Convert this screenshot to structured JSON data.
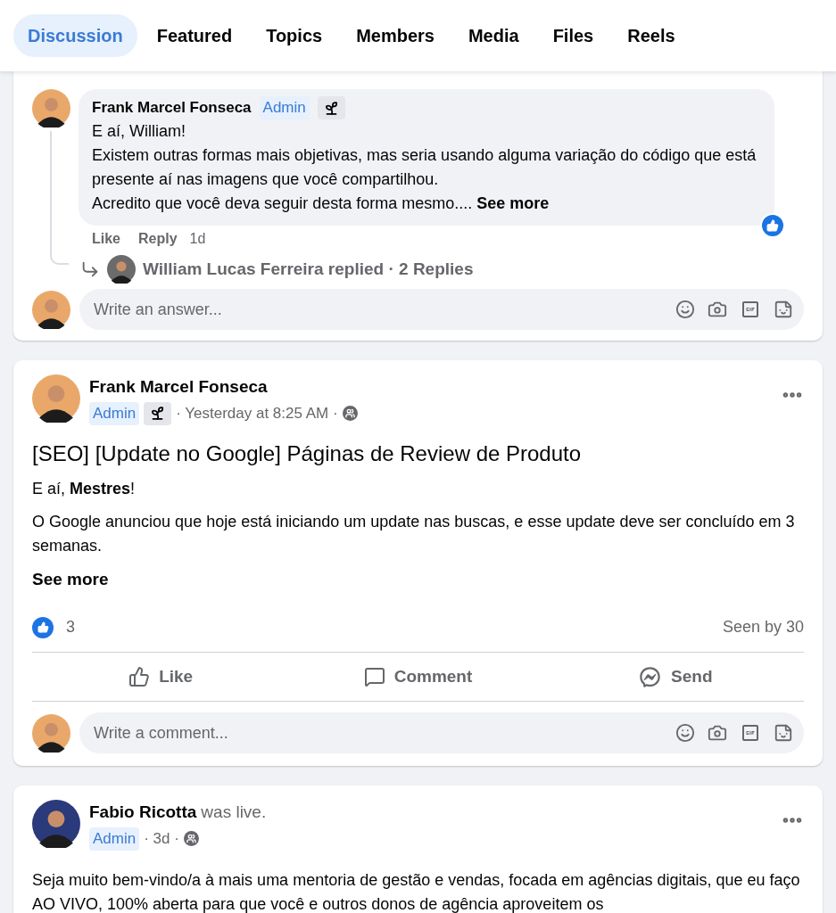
{
  "tabs": [
    {
      "label": "Discussion",
      "selected": true
    },
    {
      "label": "Featured",
      "selected": false
    },
    {
      "label": "Topics",
      "selected": false
    },
    {
      "label": "Members",
      "selected": false
    },
    {
      "label": "Media",
      "selected": false
    },
    {
      "label": "Files",
      "selected": false
    },
    {
      "label": "Reels",
      "selected": false
    }
  ],
  "comment_thread": {
    "comment": {
      "author": "Frank Marcel Fonseca",
      "badges": [
        {
          "kind": "admin",
          "label": "Admin"
        },
        {
          "kind": "sprout"
        }
      ],
      "paragraphs": [
        "E aí, William!",
        "Existem outras formas mais objetivas, mas seria usando alguma variação do código que está presente aí nas imagens que você compartilhou.",
        "Acredito que você deva seguir desta forma mesmo...."
      ],
      "see_more": "See more",
      "liked": true,
      "actions": [
        "Like",
        "Reply"
      ],
      "time": "1d"
    },
    "replies_summary": "William Lucas Ferreira replied · 2 Replies",
    "answer_field": {
      "placeholder": "Write an answer..."
    }
  },
  "posts": [
    {
      "author": "Frank Marcel Fonseca",
      "badges": [
        {
          "kind": "admin",
          "label": "Admin"
        },
        {
          "kind": "sprout"
        }
      ],
      "meta": "· Yesterday at 8:25 AM ·",
      "title": "[SEO] [Update no Google] Páginas de Review de Produto",
      "paragraphs": [
        "E aí, **Mestres**!",
        "O Google anunciou que hoje está iniciando um update nas buscas, e esse update deve ser concluído em 3 semanas."
      ],
      "see_more": "See more",
      "reactions_count": "3",
      "seen": "Seen by 30",
      "actions": [
        {
          "kind": "like",
          "label": "Like"
        },
        {
          "kind": "comment",
          "label": "Comment"
        },
        {
          "kind": "send",
          "label": "Send"
        }
      ],
      "comment_field": {
        "placeholder": "Write a comment..."
      }
    },
    {
      "author": "Fabio Ricotta",
      "suffix": "was live.",
      "badges": [
        {
          "kind": "admin",
          "label": "Admin"
        }
      ],
      "meta": "· 3d ·",
      "paragraphs": [
        "Seja muito bem-vindo/a à mais uma mentoria de gestão e vendas, focada em agências digitais, que eu faço AO VIVO, 100% aberta para que você e outros donos de agência aproveitem os"
      ]
    }
  ]
}
